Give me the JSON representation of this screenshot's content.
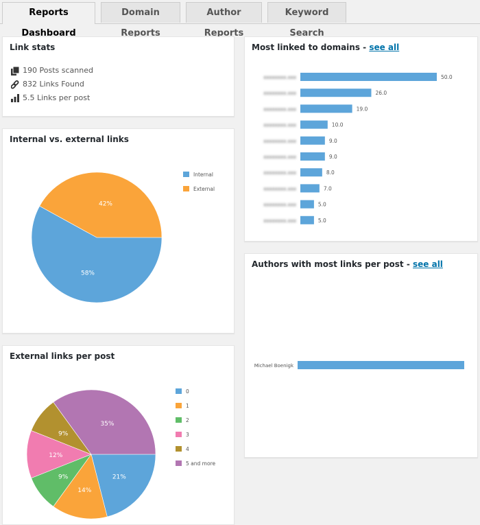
{
  "tabs": [
    {
      "label": "Reports Dashboard",
      "active": true
    },
    {
      "label": "Domain Reports",
      "active": false
    },
    {
      "label": "Author Reports",
      "active": false
    },
    {
      "label": "Keyword Search",
      "active": false
    }
  ],
  "link_stats": {
    "title": "Link stats",
    "items": [
      {
        "icon": "posts-icon",
        "text": "190 Posts scanned"
      },
      {
        "icon": "link-icon",
        "text": "832 Links Found"
      },
      {
        "icon": "bar-chart-icon",
        "text": "5.5 Links per post"
      }
    ]
  },
  "colors": {
    "blue": "#5da5da",
    "orange": "#faa43a",
    "green": "#60bd68",
    "pink": "#f17cb0",
    "olive": "#b2912f",
    "purple": "#b276b2",
    "link": "#0073aa"
  },
  "chart_data": [
    {
      "id": "internal-external",
      "type": "pie",
      "title": "Internal vs. external links",
      "legend_position": "right",
      "categories": [
        "Internal",
        "External"
      ],
      "values": [
        58,
        42
      ],
      "labels": [
        "58%",
        "42%"
      ],
      "colors": [
        "#5da5da",
        "#faa43a"
      ]
    },
    {
      "id": "external-per-post",
      "type": "pie",
      "title": "External links per post",
      "legend_position": "right",
      "categories": [
        "0",
        "1",
        "2",
        "3",
        "4",
        "5 and more"
      ],
      "values": [
        21,
        14,
        9,
        12,
        9,
        35
      ],
      "labels": [
        "21%",
        "14%",
        "9%",
        "12%",
        "9%",
        "35%"
      ],
      "colors": [
        "#5da5da",
        "#faa43a",
        "#60bd68",
        "#f17cb0",
        "#b2912f",
        "#b276b2"
      ]
    },
    {
      "id": "domains",
      "type": "bar",
      "orientation": "horizontal",
      "title": "Most linked to domains - ",
      "link_label": "see all",
      "categories": [
        "[redacted]",
        "[redacted]",
        "[redacted]",
        "[redacted]",
        "[redacted]",
        "[redacted]",
        "[redacted]",
        "[redacted]",
        "[redacted]",
        "[redacted]"
      ],
      "values": [
        50.0,
        26.0,
        19.0,
        10.0,
        9.0,
        9.0,
        8.0,
        7.0,
        5.0,
        5.0
      ],
      "value_labels": [
        "50.0",
        "26.0",
        "19.0",
        "10.0",
        "9.0",
        "9.0",
        "8.0",
        "7.0",
        "5.0",
        "5.0"
      ],
      "color": "#5da5da"
    },
    {
      "id": "authors",
      "type": "bar",
      "orientation": "horizontal",
      "title": "Authors with most links per post - ",
      "link_label": "see all",
      "categories": [
        "Michael Boenigk"
      ],
      "values": [
        1
      ],
      "color": "#5da5da"
    }
  ]
}
